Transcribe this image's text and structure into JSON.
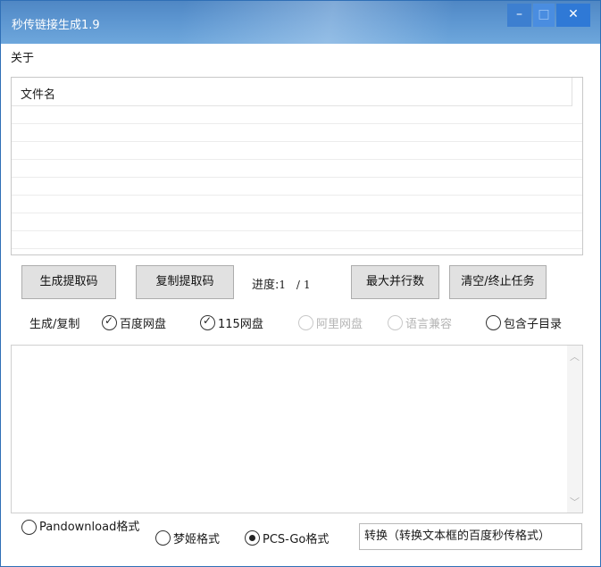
{
  "window": {
    "title": "秒传链接生成1.9",
    "controls": {
      "minimize": "–",
      "maximize": "□",
      "close": "✕"
    }
  },
  "menu": {
    "about": "关于"
  },
  "file_list": {
    "columns": [
      "文件名"
    ],
    "rows": []
  },
  "actions": {
    "generate": "生成提取码",
    "copy": "复制提取码",
    "progress_label": "进度:",
    "progress_current": "1",
    "progress_sep": "/",
    "progress_total": "1",
    "max_parallel": "最大并行数",
    "clear_stop": "清空/终止任务"
  },
  "options": {
    "label": "生成/复制",
    "baidu": {
      "label": "百度网盘",
      "checked": true,
      "enabled": true
    },
    "pan115": {
      "label": "115网盘",
      "checked": true,
      "enabled": true
    },
    "aliyun": {
      "label": "阿里网盘",
      "checked": false,
      "enabled": false
    },
    "lang_compat": {
      "label": "语言兼容",
      "checked": false,
      "enabled": false
    },
    "include_subdirs": {
      "label": "包含子目录",
      "checked": false,
      "enabled": true
    }
  },
  "output": {
    "text": ""
  },
  "formats": {
    "pandownload": {
      "label": "Pandownload格式",
      "selected": false
    },
    "mengji": {
      "label": "梦姬格式",
      "selected": false
    },
    "pcsgo": {
      "label": "PCS-Go格式",
      "selected": true
    }
  },
  "convert": {
    "label": "转换（转换文本框的百度秒传格式）"
  },
  "colors": {
    "titlebar": "#5b94cf",
    "close_button": "#2f79d6",
    "button_face": "#e1e1e1"
  }
}
